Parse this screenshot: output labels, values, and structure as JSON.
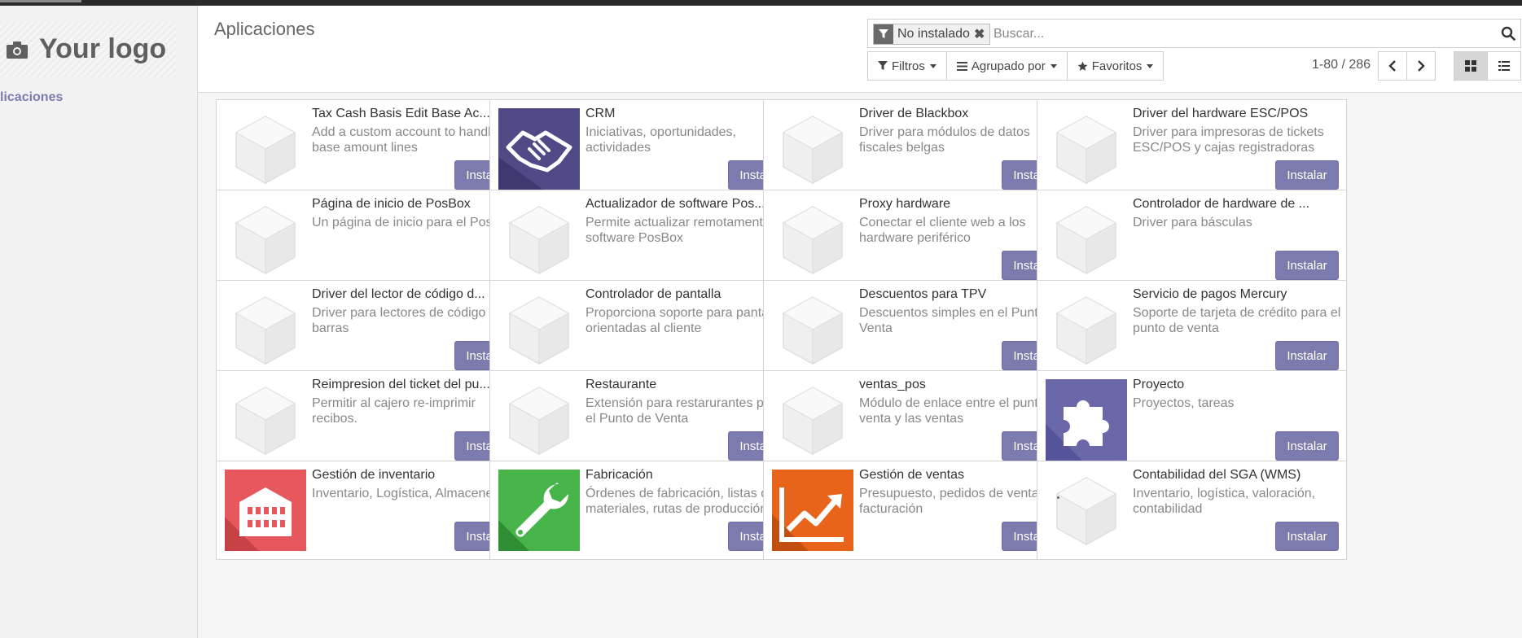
{
  "logo": {
    "text": "Your logo"
  },
  "sidebar": {
    "link": "licaciones"
  },
  "header": {
    "title": "Aplicaciones"
  },
  "search": {
    "facet": "No instalado",
    "placeholder": "Buscar..."
  },
  "filters": {
    "filters_label": "Filtros",
    "groupby_label": "Agrupado por",
    "favorites_label": "Favoritos"
  },
  "pager": {
    "value": "1-80 / 286"
  },
  "colors": {
    "accent": "#7c7bad"
  },
  "apps": [
    {
      "name": "Tax Cash Basis Edit Base Ac...",
      "summary": "Add a custom account to handle base amount lines",
      "button": "Instalar",
      "icon": "default-module-icon"
    },
    {
      "name": "CRM",
      "summary": "Iniciativas, oportunidades, actividades",
      "button": "Instalar",
      "icon": "handshake-icon"
    },
    {
      "name": "Driver de Blackbox",
      "summary": "Driver para módulos de datos fiscales belgas",
      "button": "Instalar",
      "icon": "default-module-icon"
    },
    {
      "name": "Driver del hardware ESC/POS",
      "summary": "Driver para impresoras de tickets ESC/POS y cajas registradoras",
      "button": "Instalar",
      "icon": "default-module-icon"
    },
    {
      "name": "Página de inicio de PosBox",
      "summary": "Un página de inicio para el PosBox",
      "button": "",
      "icon": "default-module-icon"
    },
    {
      "name": "Actualizador de software Pos...",
      "summary": "Permite actualizar remotamente el software PosBox",
      "button": "",
      "icon": "default-module-icon"
    },
    {
      "name": "Proxy hardware",
      "summary": "Conectar el cliente web a los hardware periférico",
      "button": "Instalar",
      "icon": "default-module-icon"
    },
    {
      "name": "Controlador de hardware de ...",
      "summary": "Driver para básculas",
      "button": "Instalar",
      "icon": "default-module-icon"
    },
    {
      "name": "Driver del lector de código d...",
      "summary": "Driver para lectores de código de barras",
      "button": "Instalar",
      "icon": "default-module-icon"
    },
    {
      "name": "Controlador de pantalla",
      "summary": "Proporciona soporte para pantallas orientadas al cliente",
      "button": "",
      "icon": "default-module-icon"
    },
    {
      "name": "Descuentos para TPV",
      "summary": "Descuentos simples en el Punto de Venta",
      "button": "Instalar",
      "icon": "default-module-icon"
    },
    {
      "name": "Servicio de pagos Mercury",
      "summary": "Soporte de tarjeta de crédito para el punto de venta",
      "button": "Instalar",
      "icon": "default-module-icon"
    },
    {
      "name": "Reimpresion del ticket del pu...",
      "summary": "Permitir al cajero re-imprimir recibos.",
      "button": "Instalar",
      "icon": "default-module-icon"
    },
    {
      "name": "Restaurante",
      "summary": "Extensión para restarurantes para el Punto de Venta",
      "button": "Instalar",
      "icon": "default-module-icon"
    },
    {
      "name": "ventas_pos",
      "summary": "Módulo de enlace entre el punto de venta y las ventas",
      "button": "Instalar",
      "icon": "default-module-icon"
    },
    {
      "name": "Proyecto",
      "summary": "Proyectos, tareas",
      "button": "Instalar",
      "icon": "puzzle-icon"
    },
    {
      "name": "Gestión de inventario",
      "summary": "Inventario, Logística, Almacenes",
      "button": "Instalar",
      "icon": "warehouse-icon"
    },
    {
      "name": "Fabricación",
      "summary": "Órdenes de fabricación, listas de materiales, rutas de producción",
      "button": "Instalar",
      "icon": "wrench-icon"
    },
    {
      "name": "Gestión de ventas",
      "summary": "Presupuesto, pedidos de venta, facturación",
      "button": "Instalar",
      "icon": "chart-up-icon"
    },
    {
      "name": "Contabilidad del SGA (WMS)",
      "summary": "Inventario, logística, valoración, contabilidad",
      "button": "Instalar",
      "icon": "default-module-icon"
    }
  ]
}
